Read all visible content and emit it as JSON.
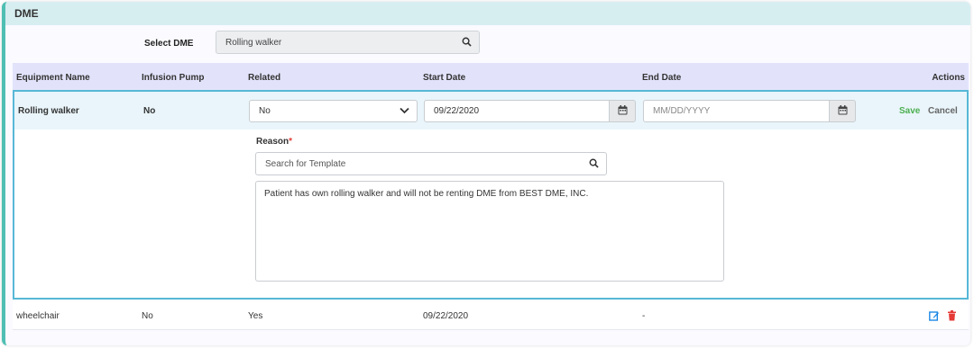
{
  "panel": {
    "title": "DME"
  },
  "select_dme": {
    "label": "Select DME",
    "value": "Rolling walker"
  },
  "table": {
    "headers": {
      "equipment": "Equipment Name",
      "infusion": "Infusion Pump",
      "related": "Related",
      "start": "Start Date",
      "end": "End Date",
      "actions": "Actions"
    }
  },
  "edit_row": {
    "equipment": "Rolling walker",
    "infusion": "No",
    "related": "No",
    "start_date": "09/22/2020",
    "end_date_placeholder": "MM/DD/YYYY",
    "save": "Save",
    "cancel": "Cancel",
    "reason_label": "Reason",
    "required_mark": "*",
    "template_placeholder": "Search for Template",
    "reason_text": "Patient has own rolling walker and will not be renting DME from BEST DME, INC."
  },
  "rows": [
    {
      "equipment": "wheelchair",
      "infusion": "No",
      "related": "Yes",
      "start_date": "09/22/2020",
      "end_date": "-"
    }
  ],
  "colors": {
    "accent": "#4fbfb3",
    "save": "#4caf50",
    "delete": "#e53935",
    "edit": "#1e88e5"
  }
}
